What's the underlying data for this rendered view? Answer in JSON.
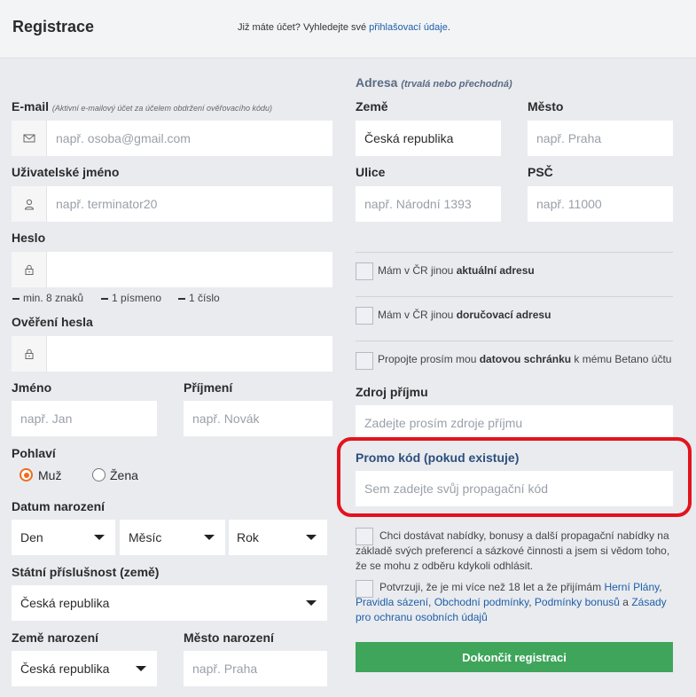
{
  "header": {
    "title": "Registrace",
    "login_prefix": "Již máte účet? Vyhledejte své ",
    "login_link": "přihlašovací údaje",
    "login_suffix": "."
  },
  "left": {
    "email": {
      "label": "E-mail",
      "note": "(Aktivní e-mailový účet za účelem obdržení ověřovacího kódu)",
      "placeholder": "např. osoba@gmail.com"
    },
    "username": {
      "label": "Uživatelské jméno",
      "placeholder": "např. terminator20"
    },
    "password": {
      "label": "Heslo",
      "rules": [
        "min. 8 znaků",
        "1 písmeno",
        "1 číslo"
      ]
    },
    "password_confirm": {
      "label": "Ověření hesla"
    },
    "first_name": {
      "label": "Jméno",
      "placeholder": "např. Jan"
    },
    "last_name": {
      "label": "Příjmení",
      "placeholder": "např. Novák"
    },
    "gender": {
      "label": "Pohlaví",
      "options": [
        "Muž",
        "Žena"
      ],
      "selected": "Muž"
    },
    "birth_date": {
      "label": "Datum narození",
      "day": "Den",
      "month": "Měsíc",
      "year": "Rok"
    },
    "citizenship": {
      "label": "Státní příslušnost (země)",
      "value": "Česká republika"
    },
    "birth_country": {
      "label": "Země narození",
      "value": "Česká republika"
    },
    "birth_city": {
      "label": "Město narození",
      "placeholder": "např. Praha"
    }
  },
  "right": {
    "address": {
      "title": "Adresa",
      "title_note": "(trvalá nebo přechodná)"
    },
    "country": {
      "label": "Země",
      "value": "Česká republika"
    },
    "city": {
      "label": "Město",
      "placeholder": "např. Praha"
    },
    "street": {
      "label": "Ulice",
      "placeholder": "např. Národní 1393"
    },
    "zip": {
      "label": "PSČ",
      "placeholder": "např. 11000"
    },
    "checks": [
      {
        "prefix": "Mám v ČR jinou ",
        "bold": "aktuální adresu",
        "suffix": ""
      },
      {
        "prefix": "Mám v ČR jinou ",
        "bold": "doručovací adresu",
        "suffix": ""
      },
      {
        "prefix": "Propojte prosím mou ",
        "bold": "datovou schránku",
        "suffix": " k mému Betano účtu"
      }
    ],
    "income": {
      "label": "Zdroj příjmu",
      "placeholder": "Zadejte prosím zdroje příjmu"
    },
    "promo": {
      "label": "Promo kód (pokud existuje)",
      "placeholder": "Sem zadejte svůj propagační kód"
    },
    "marketing": "Chci dostávat nabídky, bonusy a další propagační nabídky na základě svých preferencí a sázkové činnosti a jsem si vědom toho, že se mohu z odběru kdykoli odhlásit.",
    "age": {
      "text": "Potvrzuji, že je mi více než 18 let a že přijímám ",
      "link1": "Herní Plány",
      "sep1": ",",
      "link2": "Pravidla sázení",
      "sep2": ", ",
      "link3": "Obchodní podmínky",
      "sep3": ", ",
      "link4": "Podmínky bonusů",
      "sep4": " a ",
      "link5": "Zásady pro ochranu osobních údajů"
    },
    "submit": "Dokončit registraci"
  },
  "colors": {
    "accent": "#f26b1d",
    "link": "#1e5fa8",
    "submit": "#3ea55a",
    "highlight": "#e2141e"
  }
}
